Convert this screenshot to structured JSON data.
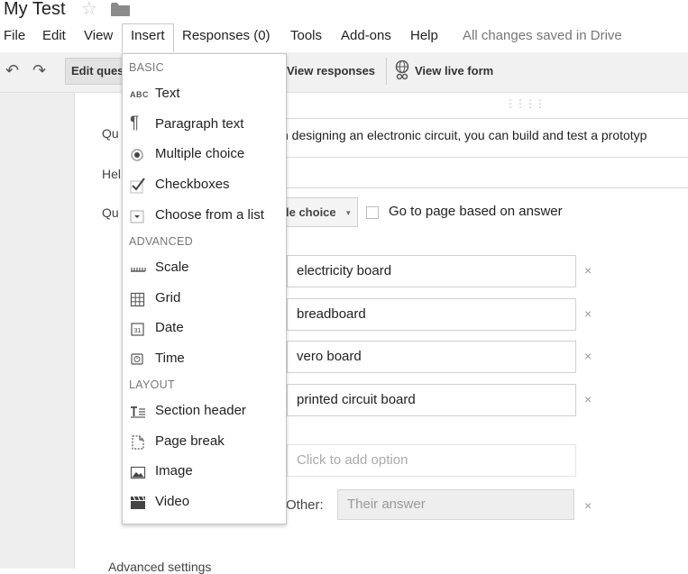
{
  "title": "My Test",
  "menubar": {
    "items": [
      "File",
      "Edit",
      "View",
      "Insert",
      "Responses (0)",
      "Tools",
      "Add-ons",
      "Help"
    ],
    "status": "All changes saved in Drive"
  },
  "toolbar": {
    "edit_tab": "Edit ques",
    "view_responses": "View responses",
    "view_live_form": "View live form"
  },
  "form": {
    "question_label": "Qu",
    "help_label": "Hel",
    "type_label": "Qu",
    "question_value": "n designing an electronic circuit, you can build and test a prototyp",
    "type_value": "le choice",
    "go_page_label": "Go to page based on answer",
    "options": [
      "electricity board",
      "breadboard",
      "vero board",
      "printed circuit board"
    ],
    "add_option_placeholder": "Click to add option",
    "other_label": "Other:",
    "other_placeholder": "Their answer",
    "advanced_settings": "Advanced settings",
    "remove_symbol": "×"
  },
  "insert_menu": {
    "sections": {
      "basic": "BASIC",
      "advanced": "ADVANCED",
      "layout": "LAYOUT"
    },
    "basic_items": [
      {
        "label": "Text",
        "icon": "text-abc-icon"
      },
      {
        "label": "Paragraph text",
        "icon": "paragraph-icon"
      },
      {
        "label": "Multiple choice",
        "icon": "radio-icon"
      },
      {
        "label": "Checkboxes",
        "icon": "checkmark-icon"
      },
      {
        "label": "Choose from a list",
        "icon": "dropdown-list-icon"
      }
    ],
    "advanced_items": [
      {
        "label": "Scale",
        "icon": "scale-icon"
      },
      {
        "label": "Grid",
        "icon": "grid-icon"
      },
      {
        "label": "Date",
        "icon": "calendar-icon"
      },
      {
        "label": "Time",
        "icon": "clock-icon"
      }
    ],
    "layout_items": [
      {
        "label": "Section header",
        "icon": "section-header-icon"
      },
      {
        "label": "Page break",
        "icon": "page-break-icon"
      },
      {
        "label": "Image",
        "icon": "image-icon"
      },
      {
        "label": "Video",
        "icon": "video-icon"
      }
    ],
    "abc_glyph": "ABC",
    "calendar_glyph": "31"
  }
}
